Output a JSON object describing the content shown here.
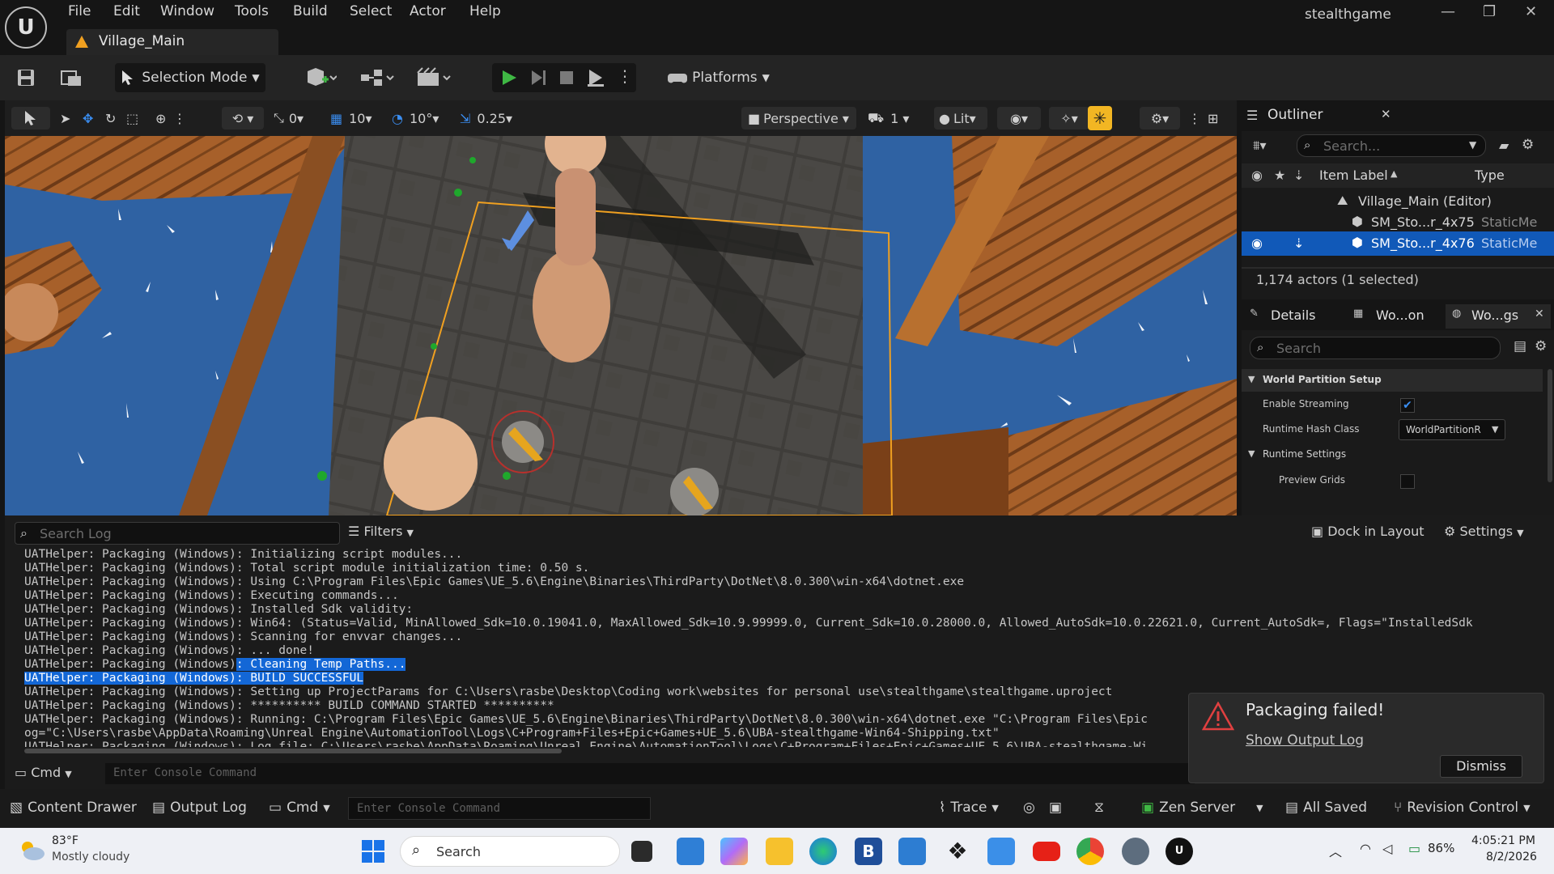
{
  "app": {
    "project_name": "stealthgame",
    "level_tab": "Village_Main",
    "menu": [
      "File",
      "Edit",
      "Window",
      "Tools",
      "Build",
      "Select",
      "Actor",
      "Help"
    ],
    "window_controls": {
      "minimize": "—",
      "maximize": "❐",
      "close": "✕"
    }
  },
  "toolbar": {
    "selection_mode": "Selection Mode",
    "platforms": "Platforms"
  },
  "viewport_toolbar": {
    "translate_snap": "0",
    "grid_snap": "10",
    "rotation_snap": "10°",
    "scale_snap": "0.25",
    "view_mode": "Perspective",
    "camera_speed": "1",
    "lighting": "Lit"
  },
  "outliner": {
    "title": "Outliner",
    "search_placeholder": "Search...",
    "col_label": "Item Label",
    "col_type": "Type",
    "rows": [
      {
        "label": "Village_Main (Editor)",
        "type": ""
      },
      {
        "label": "SM_Sto...r_4x75",
        "type": "StaticMe"
      },
      {
        "label": "SM_Sto...r_4x76",
        "type": "StaticMe"
      }
    ],
    "footer": "1,174 actors (1 selected)"
  },
  "details": {
    "tabs": [
      "Details",
      "Wo...on",
      "Wo...gs"
    ],
    "search_placeholder": "Search",
    "sections": {
      "world_partition": "World Partition Setup",
      "runtime": "Runtime Settings"
    },
    "props": {
      "enable_streaming": "Enable Streaming",
      "runtime_hash_class": "Runtime Hash Class",
      "runtime_hash_value": "WorldPartitionR",
      "preview_grids": "Preview Grids"
    }
  },
  "output_log": {
    "search_placeholder": "Search Log",
    "filters": "Filters",
    "dock_in_layout": "Dock in Layout",
    "settings": "Settings",
    "lines": [
      "UATHelper: Packaging (Windows): Initializing script modules...",
      "UATHelper: Packaging (Windows): Total script module initialization time: 0.50 s.",
      "UATHelper: Packaging (Windows): Using C:\\Program Files\\Epic Games\\UE_5.6\\Engine\\Binaries\\ThirdParty\\DotNet\\8.0.300\\win-x64\\dotnet.exe",
      "UATHelper: Packaging (Windows): Executing commands...",
      "UATHelper: Packaging (Windows): Installed Sdk validity:",
      "UATHelper: Packaging (Windows): Win64: (Status=Valid, MinAllowed_Sdk=10.0.19041.0, MaxAllowed_Sdk=10.9.99999.0, Current_Sdk=10.0.28000.0, Allowed_AutoSdk=10.0.22621.0, Current_AutoSdk=, Flags=\"InstalledSdk",
      "UATHelper: Packaging (Windows): Scanning for envvar changes...",
      "UATHelper: Packaging (Windows): ... done!",
      "UATHelper: Packaging (Windows): Setting up ProjectParams for C:\\Users\\rasbe\\Desktop\\Coding work\\websites for personal use\\stealthgame\\stealthgame.uproject",
      "UATHelper: Packaging (Windows): ********** BUILD COMMAND STARTED **********",
      "UATHelper: Packaging (Windows): Running: C:\\Program Files\\Epic Games\\UE_5.6\\Engine\\Binaries\\ThirdParty\\DotNet\\8.0.300\\win-x64\\dotnet.exe \"C:\\Program Files\\Epic",
      "og=\"C:\\Users\\rasbe\\AppData\\Roaming\\Unreal Engine\\AutomationTool\\Logs\\C+Program+Files+Epic+Games+UE_5.6\\UBA-stealthgame-Win64-Shipping.txt\"",
      "UATHelper: Packaging (Windows): Log file: C:\\Users\\rasbe\\AppData\\Roaming\\Unreal Engine\\AutomationTool\\Logs\\C+Program+Files+Epic+Games+UE_5.6\\UBA-stealthgame-Wi"
    ],
    "hl_prefix_a": "UATHelper: Packaging (Windows)",
    "hl_text_a": ": Cleaning Temp Paths...",
    "hl_text_b": "UATHelper: Packaging (Windows): BUILD SUCCESSFUL",
    "cmd_label": "Cmd",
    "console_placeholder": "Enter Console Command"
  },
  "toast": {
    "title": "Packaging failed!",
    "link": "Show Output Log",
    "dismiss": "Dismiss"
  },
  "statusbar": {
    "content_drawer": "Content Drawer",
    "output_log": "Output Log",
    "cmd": "Cmd",
    "console_placeholder": "Enter Console Command",
    "trace": "Trace",
    "zen_server": "Zen Server",
    "all_saved": "All Saved",
    "revision_control": "Revision Control"
  },
  "taskbar": {
    "temperature": "83°F",
    "weather": "Mostly cloudy",
    "search": "Search",
    "battery": "86%",
    "time": "4:05:21 PM",
    "date": "8/2/2026"
  },
  "colors": {
    "accent_blue": "#1367d6",
    "play_green": "#3fb844",
    "selection_orange": "#f0a020",
    "toast_red": "#e04040"
  }
}
